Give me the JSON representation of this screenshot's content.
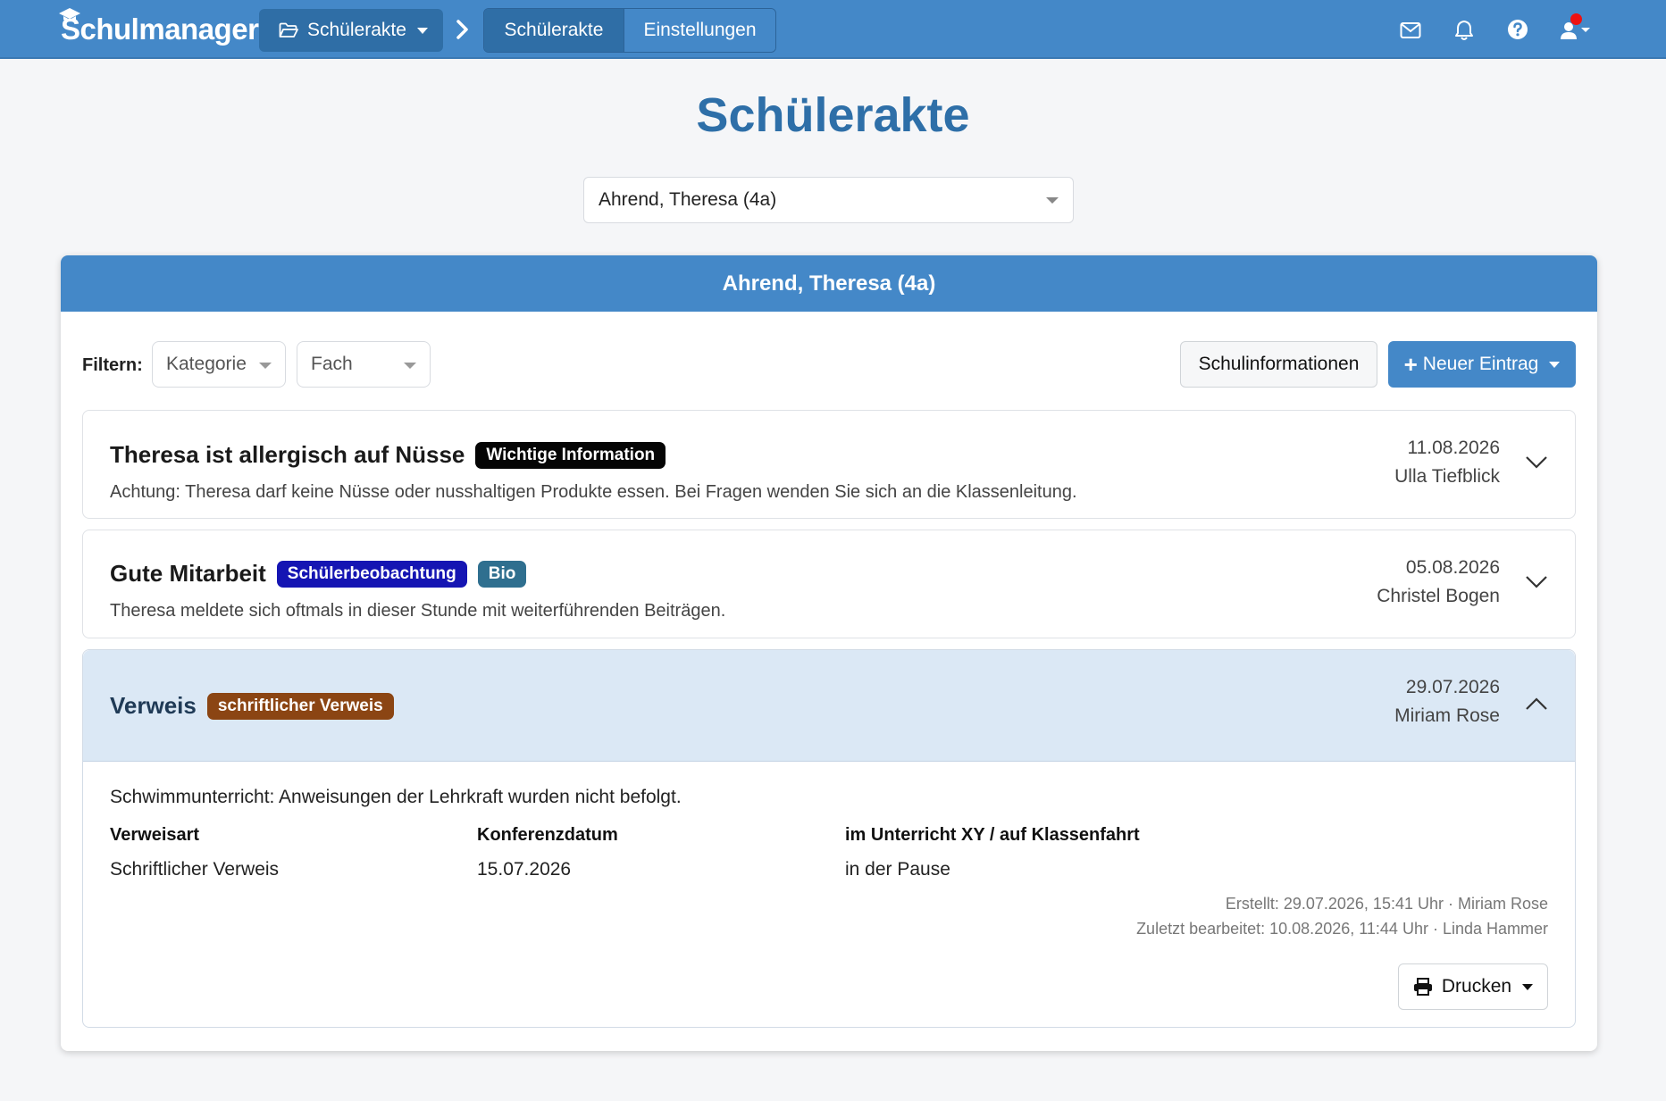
{
  "navbar": {
    "logo": "Schulmanager",
    "module_dropdown_label": "Schülerakte",
    "tabs": [
      {
        "label": "Schülerakte",
        "active": true
      },
      {
        "label": "Einstellungen",
        "active": false
      }
    ],
    "icons": [
      "mail-icon",
      "bell-icon",
      "help-icon",
      "user-icon"
    ],
    "accent": "#4488c8"
  },
  "page": {
    "title": "Schülerakte",
    "student_select_value": "Ahrend, Theresa (4a)"
  },
  "card": {
    "header": "Ahrend, Theresa (4a)",
    "filter_label": "Filtern:",
    "filter_category": "Kategorie",
    "filter_subject": "Fach",
    "school_info_button": "Schulinformationen",
    "new_entry_button": "Neuer Eintrag"
  },
  "entries": [
    {
      "title": "Theresa ist allergisch auf Nüsse",
      "badges": [
        "Wichtige Information"
      ],
      "description": "Achtung: Theresa darf keine Nüsse oder nusshaltigen Produkte essen. Bei Fragen wenden Sie sich an die Klassenleitung.",
      "date": "11.08.2026",
      "author": "Ulla Tiefblick"
    },
    {
      "title": "Gute Mitarbeit",
      "badges": [
        "Schülerbeobachtung",
        "Bio"
      ],
      "description": "Theresa meldete sich oftmals in dieser Stunde mit weiterführenden Beiträgen.",
      "date": "05.08.2026",
      "author": "Christel Bogen"
    },
    {
      "title": "Verweis",
      "badges": [
        "schriftlicher Verweis"
      ],
      "date": "29.07.2026",
      "author": "Miriam Rose",
      "expanded": true,
      "text": "Schwimmunterricht: Anweisungen der Lehrkraft wurden nicht befolgt.",
      "fields": [
        {
          "label": "Verweisart",
          "value": "Schriftlicher Verweis"
        },
        {
          "label": "Konferenzdatum",
          "value": "15.07.2026"
        },
        {
          "label": "im Unterricht XY / auf Klassenfahrt",
          "value": "in der Pause"
        }
      ],
      "created": "Erstellt: 29.07.2026, 15:41 Uhr · Miriam Rose",
      "edited": "Zuletzt bearbeitet: 10.08.2026, 11:44 Uhr · Linda Hammer",
      "print_button": "Drucken"
    }
  ]
}
